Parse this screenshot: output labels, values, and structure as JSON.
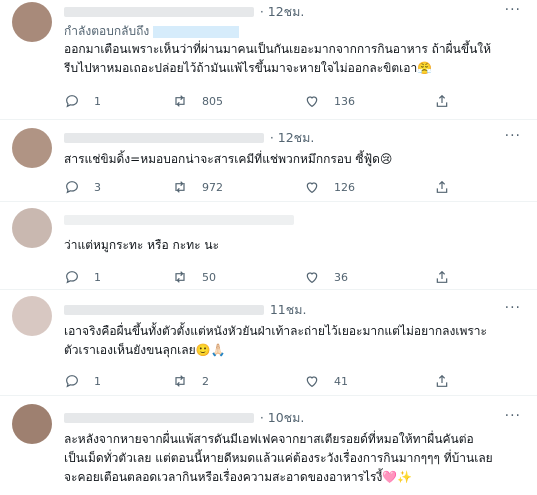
{
  "tweets": [
    {
      "avatar_color": "#a88a7a",
      "time": "· 12ชม.",
      "reply_label": "กำลังตอบกลับถึง",
      "lines": [
        "ออกมาเตือนเพราะเห็นว่าที่ผ่านมาคนเป็นกันเยอะมากจากการกินอาหาร ถ้าผื่นขึ้นให้",
        "รีบไปหาหมอเถอะปล่อยไว้ถ้ามันแพ้ไรขึ้นมาจะหายใจไม่ออกละขิตเอา😤"
      ],
      "replies": "1",
      "retweets": "805",
      "likes": "136"
    },
    {
      "avatar_color": "#b09484",
      "time": "· 12ชม.",
      "lines": [
        "สารแช่ขิมดิ้ง=หมอบอกน่าจะสารเคมีที่แช่พวกหมึกกรอบ ซี้ฟู้ด😢"
      ],
      "replies": "3",
      "retweets": "972",
      "likes": "126"
    },
    {
      "avatar_color": "#c9b8b0",
      "time": "",
      "lines": [
        "ว่าแต่หมูกระทะ หรือ กะทะ นะ"
      ],
      "replies": "1",
      "retweets": "50",
      "likes": "36"
    },
    {
      "avatar_color": "#d8c8c2",
      "time": "11ชม.",
      "lines": [
        "เอาจริงคือผื่นขึ้นทั้งตัวตั้งแต่หนังหัวยันฝ่าเท้าละถ่ายไว้เยอะมากแต่ไม่อยากลงเพราะ",
        "ตัวเราเองเห็นยังขนลุกเลย🙂🙏🏻"
      ],
      "replies": "1",
      "retweets": "2",
      "likes": "41"
    },
    {
      "avatar_color": "#9e8070",
      "time": "· 10ชม.",
      "lines": [
        "ละหลังจากหายจากผื่นแพ้สารดันมีเอฟเฟคจากยาสเตียรอยด์ที่หมอให้ทาผื่นคันต่อ",
        "เป็นเม็ดทั่วตัวเลย แต่ตอนนี้หายดีหมดแล้วแค่ต้องระวังเรื่องการกินมากๆๆๆ ที่บ้านเลย",
        "จะคอยเตือนตลอดเวลากินหรือเรื่องความสะอาดของอาหารไรงี้🩷✨"
      ]
    }
  ],
  "more_icon": "more-dots-icon",
  "colors": {
    "muted": "#536471",
    "handle_highlight": "#d6ecfb",
    "border": "#eff3f4"
  }
}
